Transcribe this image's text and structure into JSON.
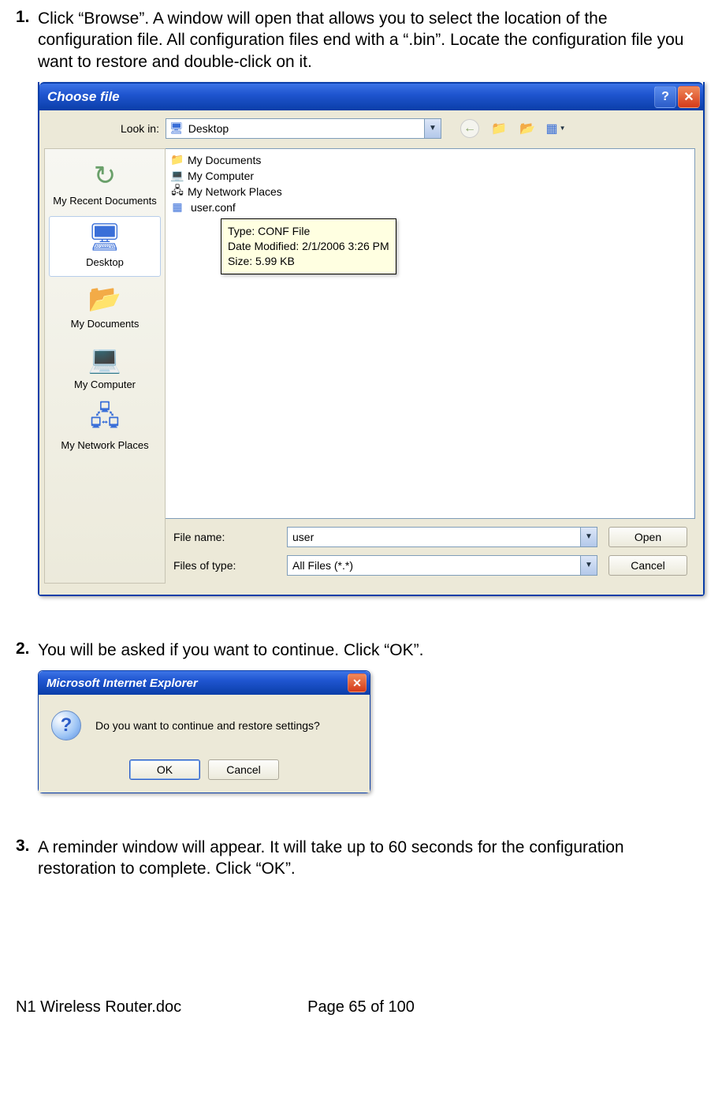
{
  "steps": {
    "s1_num": "1.",
    "s1_text": "Click “Browse”. A window will open that allows you to select the location of the configuration file. All configuration files end with a “.bin”. Locate the configuration file you want to restore and double-click on it.",
    "s2_num": "2.",
    "s2_text": "You will be asked if you want to continue. Click “OK”.",
    "s3_num": "3.",
    "s3_text": "A reminder window will appear. It will take up to 60 seconds for the configuration restoration to complete. Click “OK”."
  },
  "dialog1": {
    "title": "Choose file",
    "lookin_label": "Look in:",
    "lookin_value": "Desktop",
    "places": {
      "recent": "My Recent Documents",
      "desktop": "Desktop",
      "docs": "My Documents",
      "comp": "My Computer",
      "net": "My Network Places"
    },
    "files": {
      "f1": "My Documents",
      "f2": "My Computer",
      "f3": "My Network Places",
      "f4": "user.conf"
    },
    "tooltip": {
      "l1": "Type: CONF File",
      "l2": "Date Modified: 2/1/2006 3:26 PM",
      "l3": "Size: 5.99 KB"
    },
    "filename_label": "File name:",
    "filename_value": "user",
    "filetype_label": "Files of type:",
    "filetype_value": "All Files (*.*)",
    "open_btn": "Open",
    "cancel_btn": "Cancel"
  },
  "dialog2": {
    "title": "Microsoft Internet Explorer",
    "message": "Do you want to continue and restore settings?",
    "ok_btn": "OK",
    "cancel_btn": "Cancel"
  },
  "footer": {
    "doc": "N1 Wireless Router.doc",
    "page": "Page 65 of 100"
  }
}
